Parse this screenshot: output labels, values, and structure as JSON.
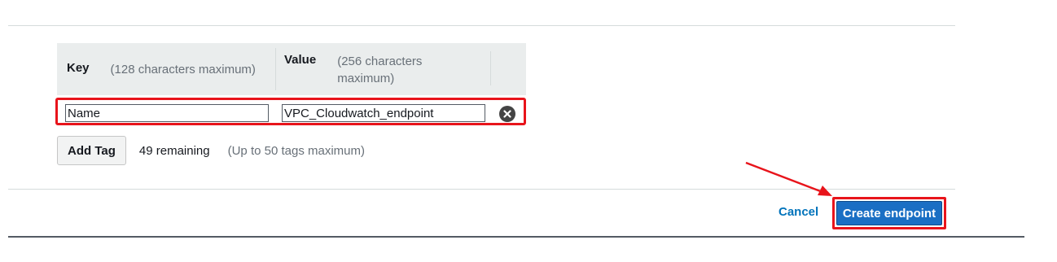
{
  "tags_table": {
    "key_header": "Key",
    "key_hint": "(128 characters maximum)",
    "value_header": "Value",
    "value_hint": "(256 characters maximum)",
    "rows": [
      {
        "key": "Name",
        "value": "VPC_Cloudwatch_endpoint"
      }
    ]
  },
  "add_tag": {
    "button_label": "Add Tag",
    "remaining": "49 remaining",
    "limit_note": "(Up to 50 tags maximum)"
  },
  "footer": {
    "cancel_label": "Cancel",
    "create_label": "Create endpoint"
  },
  "colors": {
    "highlight": "#e8141b",
    "primary_button": "#1a6fc4",
    "link": "#0073bb"
  },
  "icons": {
    "remove": "close-circle-icon",
    "annotation": "red-arrow-icon"
  }
}
